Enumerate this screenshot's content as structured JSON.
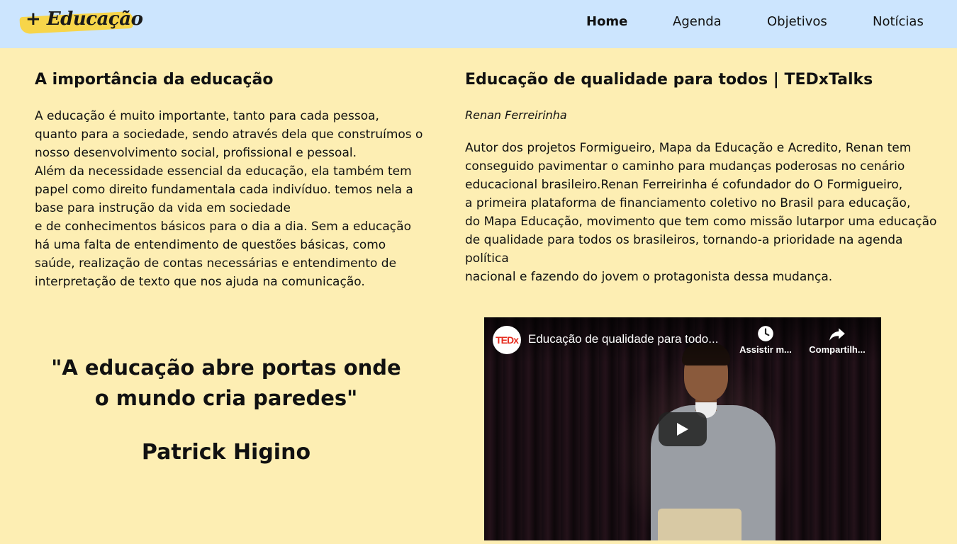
{
  "nav": {
    "logo": "+ Educação",
    "links": [
      "Home",
      "Agenda",
      "Objetivos",
      "Notícias"
    ],
    "active": "Home"
  },
  "left": {
    "title": "A importância da educação",
    "paragraph_lines": [
      "A educação é muito importante, tanto para cada pessoa,",
      "quanto para a sociedade, sendo através dela que construímos o",
      "nosso desenvolvimento social, profissional e pessoal.",
      "Além da necessidade essencial da educação, ela também tem",
      "papel como direito fundamentala cada indivíduo. temos nela a",
      "base para instrução da vida em sociedade",
      "e de conhecimentos básicos para o dia a dia. Sem a educação",
      "há uma falta de entendimento de questões básicas, como",
      "saúde, realização de contas necessárias e entendimento de",
      "interpretação de texto que nos ajuda na comunicação."
    ],
    "quote_lines": [
      "\"A educação abre portas onde",
      "o mundo cria paredes\""
    ],
    "quote_author": "Patrick Higino"
  },
  "right": {
    "title": "Educação de qualidade para todos | TEDxTalks",
    "author": "Renan Ferreirinha",
    "paragraph_lines": [
      "Autor dos projetos Formigueiro, Mapa da Educação e Acredito, Renan tem",
      "conseguido pavimentar o caminho para mudanças poderosas no cenário",
      "educacional brasileiro.Renan Ferreirinha é cofundador do O Formigueiro,",
      "a primeira plataforma de financiamento coletivo no Brasil para educação,",
      "do Mapa Educação, movimento que tem como missão lutarpor uma educação",
      "de qualidade para todos os brasileiros, tornando-a prioridade na agenda",
      "política",
      "nacional e fazendo do jovem o protagonista dessa mudança."
    ]
  },
  "video": {
    "channel_avatar": "TEDx",
    "title": "Educação de qualidade para todo...",
    "watch_later": "Assistir m...",
    "share": "Compartilh..."
  }
}
